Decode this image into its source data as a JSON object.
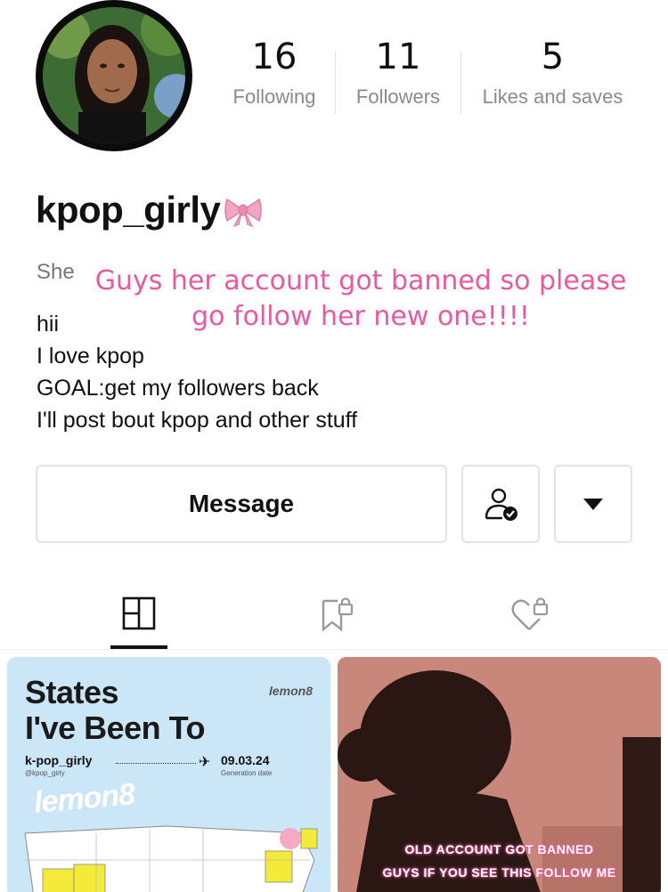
{
  "profile": {
    "username": "kpop_girly",
    "pronoun": "She",
    "bio_lines": [
      "hii",
      "I love kpop",
      "GOAL:get my followers back",
      "I'll post bout kpop and other stuff"
    ],
    "overlay_line1": "Guys her account got banned so please",
    "overlay_line2": "go follow her new one!!!!"
  },
  "stats": {
    "following": {
      "count": "16",
      "label": "Following"
    },
    "followers": {
      "count": "11",
      "label": "Followers"
    },
    "likes": {
      "count": "5",
      "label": "Likes and saves"
    }
  },
  "actions": {
    "message_label": "Message"
  },
  "posts": {
    "post1": {
      "title_line1": "States",
      "title_line2": "I've Been To",
      "brand": "lemon8",
      "user": "k-pop_girly",
      "handle": "@kpop_girly",
      "date": "09.03.24",
      "date_caption": "Generation date",
      "logo": "lemon8"
    },
    "post2": {
      "line1": "OLD ACCOUNT GOT BANNED",
      "line2": "GUYS IF YOU SEE THIS FOLLOW ME"
    }
  },
  "colors": {
    "overlay_pink": "#e85aa0",
    "bow_pink": "#f2a6c4"
  }
}
